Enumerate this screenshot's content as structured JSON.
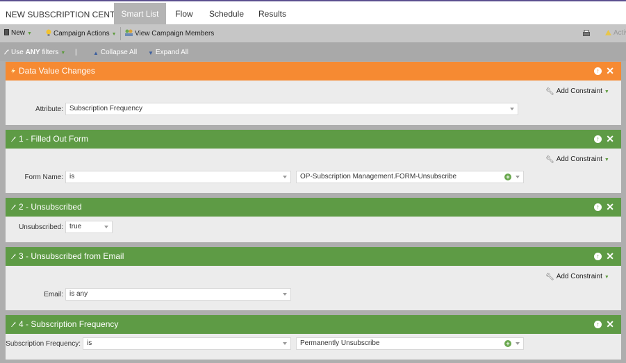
{
  "app": {
    "title": "NEW SUBSCRIPTION CENTER"
  },
  "tabs": [
    {
      "label": "Smart List",
      "active": true
    },
    {
      "label": "Flow",
      "active": false
    },
    {
      "label": "Schedule",
      "active": false
    },
    {
      "label": "Results",
      "active": false
    }
  ],
  "toolbar": {
    "new_label": "New",
    "campaign_actions_label": "Campaign Actions",
    "view_members_label": "View Campaign Members",
    "activate_label": "Activ"
  },
  "filterbar": {
    "use_prefix": "Use",
    "use_mode": "ANY",
    "use_suffix": "filters",
    "separator": "|",
    "collapse_all": "Collapse All",
    "expand_all": "Expand All"
  },
  "add_constraint_label": "Add Constraint",
  "panels": [
    {
      "title": "Data Value Changes",
      "color": "#f68a32",
      "fields": [
        {
          "label": "Attribute:",
          "value": "Subscription Frequency"
        }
      ]
    },
    {
      "title": "1 - Filled Out Form",
      "color": "#5e9b45",
      "fields": [
        {
          "label": "Form Name:",
          "operator": "is",
          "value": "OP-Subscription Management.FORM-Unsubscribe"
        }
      ]
    },
    {
      "title": "2 - Unsubscribed",
      "color": "#5e9b45",
      "fields": [
        {
          "label": "Unsubscribed:",
          "value": "true"
        }
      ]
    },
    {
      "title": "3 - Unsubscribed from Email",
      "color": "#5e9b45",
      "fields": [
        {
          "label": "Email:",
          "value": "is any"
        }
      ]
    },
    {
      "title": "4 - Subscription Frequency",
      "color": "#5e9b45",
      "fields": [
        {
          "label": "Subscription Frequency:",
          "operator": "is",
          "value": "Permanently Unsubscribe"
        }
      ]
    }
  ],
  "icons": {
    "new": "document-icon",
    "campaign_actions": "lightbulb-icon",
    "view_members": "people-icon",
    "print": "printer-icon",
    "activate": "warning-icon",
    "filter": "wrench-icon",
    "collapse": "collapse-icon",
    "expand": "expand-icon",
    "panel_up": "arrow-up-icon",
    "panel_close": "close-icon",
    "value_add": "plus-circle-icon"
  }
}
